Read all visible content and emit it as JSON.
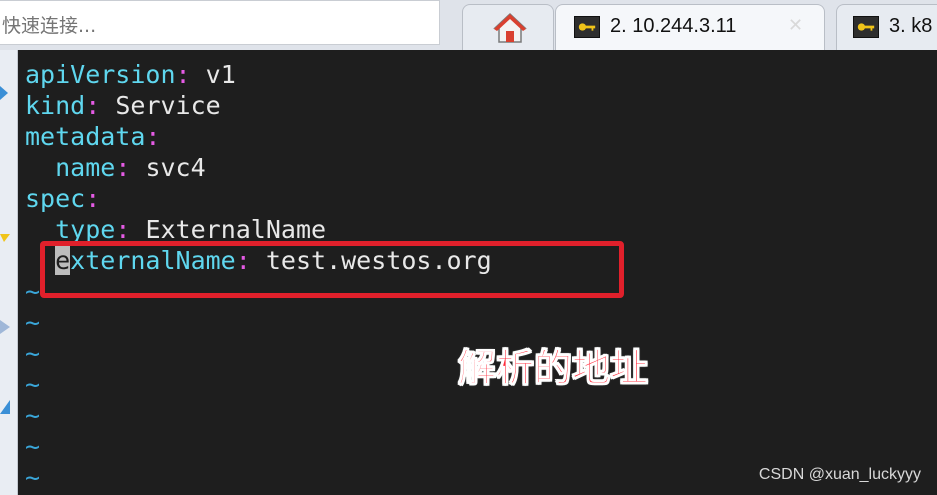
{
  "toolbar": {
    "quick_connect_placeholder": "快速连接..."
  },
  "tabs": [
    {
      "label": "",
      "icon": "home-icon"
    },
    {
      "label": "2. 10.244.3.11",
      "icon": "key-icon",
      "close": "✕"
    },
    {
      "label": "3. k8",
      "icon": "key-icon"
    }
  ],
  "editor": {
    "lines": [
      {
        "indent": "",
        "key": "apiVersion",
        "value": "v1"
      },
      {
        "indent": "",
        "key": "kind",
        "value": "Service"
      },
      {
        "indent": "",
        "key": "metadata",
        "value": ""
      },
      {
        "indent": "  ",
        "key": "name",
        "value": "svc4"
      },
      {
        "indent": "",
        "key": "spec",
        "value": ""
      },
      {
        "indent": "  ",
        "key": "type",
        "value": "ExternalName"
      },
      {
        "indent": "  ",
        "key_cursor_char": "e",
        "key": "xternalName",
        "value": "test.westos.org"
      }
    ],
    "tilde": "~",
    "empty_line_count": 7
  },
  "annotation": {
    "text": "解析的地址",
    "color": "#ff2a3a"
  },
  "watermark": "CSDN @xuan_luckyyy",
  "colors": {
    "background": "#1e1e1e",
    "yaml_key": "#5fd7ef",
    "yaml_colon": "#e55be5",
    "tilde": "#3aa6d9",
    "highlight_box": "#e0202b"
  }
}
